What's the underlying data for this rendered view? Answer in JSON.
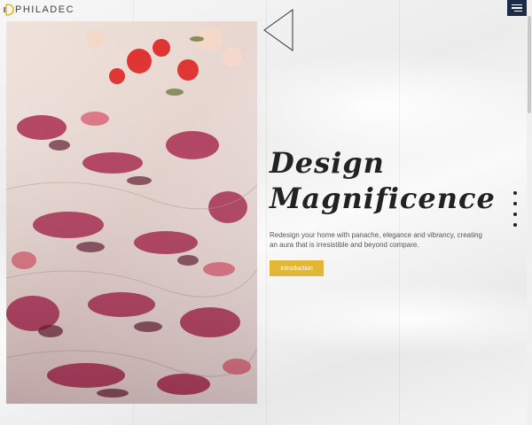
{
  "brand": {
    "name": "PHILADEC",
    "accent": "#e2b735"
  },
  "header": {
    "menu_icon": "hamburger-menu-icon",
    "menu_color": "#1c2b4a"
  },
  "hero": {
    "headline_line1": "Design",
    "headline_line2": "Magnificence",
    "description": "Redesign your home with panache, elegance and vibrancy, creating an aura that is irresistible and beyond compare.",
    "cta_label": "Introduction",
    "image_alt": "pink and maroon patterned fabric"
  },
  "slides": {
    "count": 4,
    "active_index": 0
  }
}
